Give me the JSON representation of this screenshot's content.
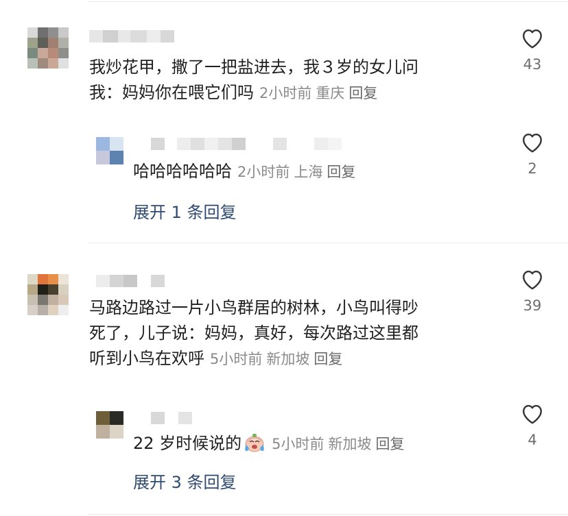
{
  "comments": [
    {
      "text_lines": [
        "我炒花甲，撒了一把盐进去，我３岁的女儿问",
        "我：妈妈你在喂它们吗"
      ],
      "time": "2小时前",
      "location": "重庆",
      "reply_label": "回复",
      "likes": "43",
      "replies": [
        {
          "text": "哈哈哈哈哈哈",
          "time": "2小时前",
          "location": "上海",
          "reply_label": "回复",
          "likes": "2"
        }
      ],
      "expand_label": "展开 1 条回复"
    },
    {
      "text_lines": [
        "马路边路过一片小鸟群居的树林，小鸟叫得吵",
        "死了，儿子说：妈妈，真好，每次路过这里都",
        "听到小鸟在欢呼"
      ],
      "time": "5小时前",
      "location": "新加坡",
      "reply_label": "回复",
      "likes": "39",
      "replies": [
        {
          "text": "22 岁时候说的",
          "emoji": "crying-laughing-emoji",
          "time": "5小时前",
          "location": "新加坡",
          "reply_label": "回复",
          "likes": "4"
        }
      ],
      "expand_label": "展开 3 条回复"
    }
  ],
  "colors": {
    "link": "#2f4a72",
    "meta": "#8a8a8a",
    "icon": "#333333"
  }
}
